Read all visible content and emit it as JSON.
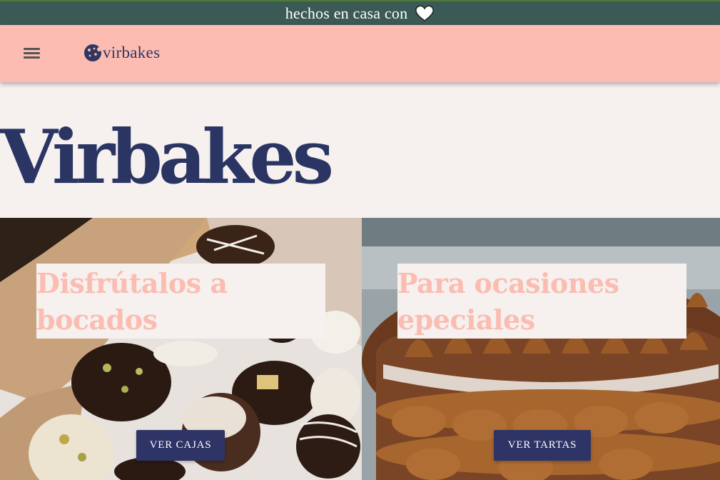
{
  "topbar": {
    "text": "hechos en casa con",
    "icon": "heart-icon"
  },
  "navbar": {
    "menu_icon": "hamburger-menu-icon",
    "logo_icon": "cookie-icon",
    "logo_text": "virbakes"
  },
  "hero": {
    "title": "Virbakes"
  },
  "panels": [
    {
      "caption": "Disfrútalos a bocados",
      "button_label": "VER CAJAS",
      "image": "cookie-box-photo"
    },
    {
      "caption": "Para ocasiones epeciales",
      "button_label": "VER TARTAS",
      "image": "caramel-layer-cake-photo"
    }
  ],
  "colors": {
    "topbar_bg": "#3b5955",
    "navbar_bg": "#fdbcb1",
    "page_bg": "#f6f0ee",
    "title_navy": "#2a3564",
    "caption_pink": "#fbbcb1",
    "button_navy": "#2e3466"
  }
}
